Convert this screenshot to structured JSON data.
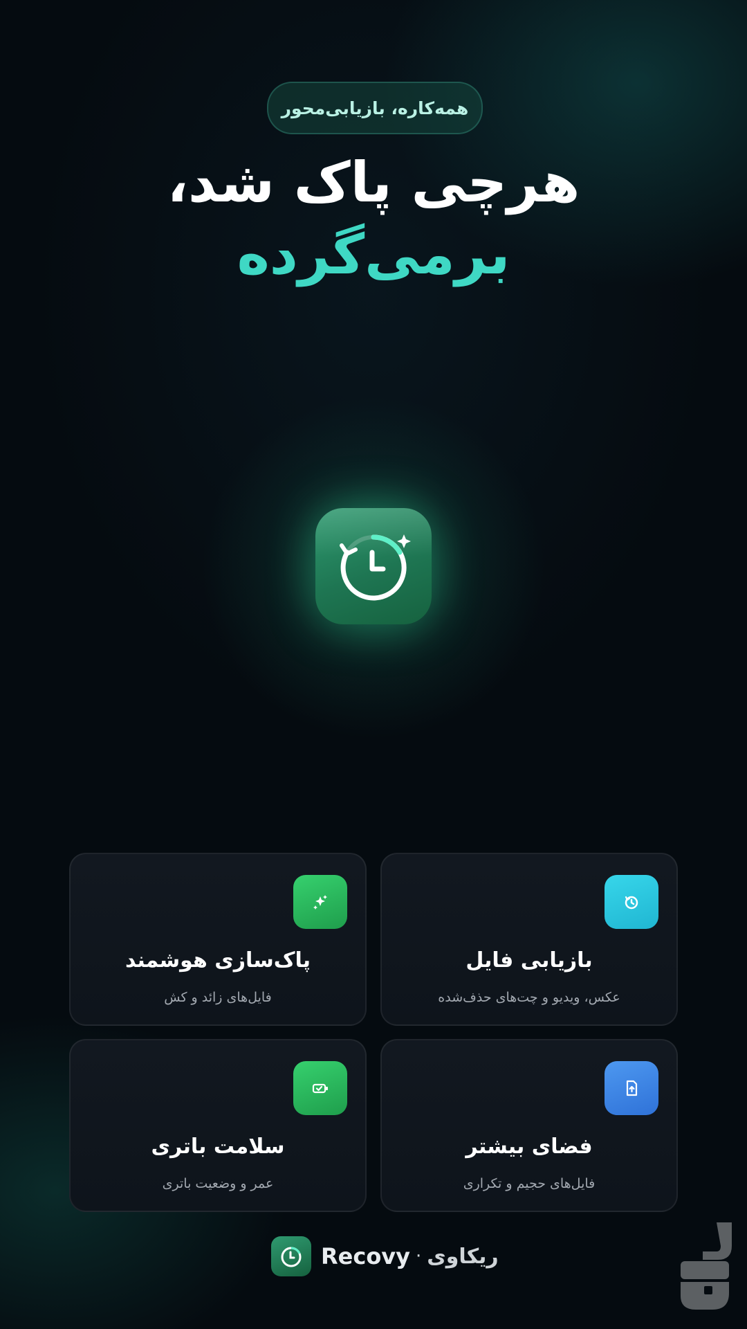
{
  "badge": {
    "label": "همه‌کاره، بازیابی‌محور"
  },
  "headline": {
    "line1": "هرچی پاک شد،",
    "line2": "برمی‌گرده"
  },
  "features": [
    {
      "title": "بازیابی فایل",
      "subtitle": "عکس، ویدیو و چت‌های حذف‌شده",
      "icon": "restore-clock-icon",
      "color": "#2cc8e0"
    },
    {
      "title": "پاک‌سازی هوشمند",
      "subtitle": "فایل‌های زائد و کش",
      "icon": "sparkle-icon",
      "color": "#27b85d"
    },
    {
      "title": "فضای بیشتر",
      "subtitle": "فایل‌های حجیم و تکراری",
      "icon": "file-upload-icon",
      "color": "#3b86e8"
    },
    {
      "title": "سلامت باتری",
      "subtitle": "عمر و وضعیت باتری",
      "icon": "battery-icon",
      "color": "#27b85d"
    }
  ],
  "footer": {
    "brand_en": "Recovy",
    "separator": "·",
    "brand_fa": "ریکاوی"
  },
  "colors": {
    "accent_teal": "#3fd8c4",
    "app_green": "#1e7552",
    "background": "#050b10"
  }
}
